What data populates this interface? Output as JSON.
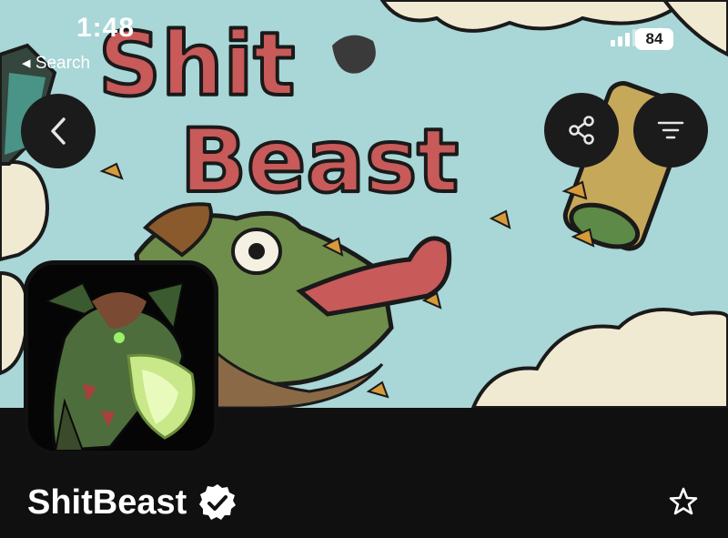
{
  "status_bar": {
    "time": "1:48",
    "back_label": "◂ Search",
    "battery": "84"
  },
  "header": {
    "back_icon": "chevron-left-icon",
    "share_icon": "share-icon",
    "filter_icon": "filter-icon"
  },
  "collection": {
    "name": "ShitBeast",
    "verified": true
  },
  "actions": {
    "favorite_icon": "star-icon"
  },
  "colors": {
    "background": "#101010",
    "button_bg": "#1b1b1b",
    "banner_sky": "#a9d6d6",
    "banner_title": "#c85a5a"
  }
}
